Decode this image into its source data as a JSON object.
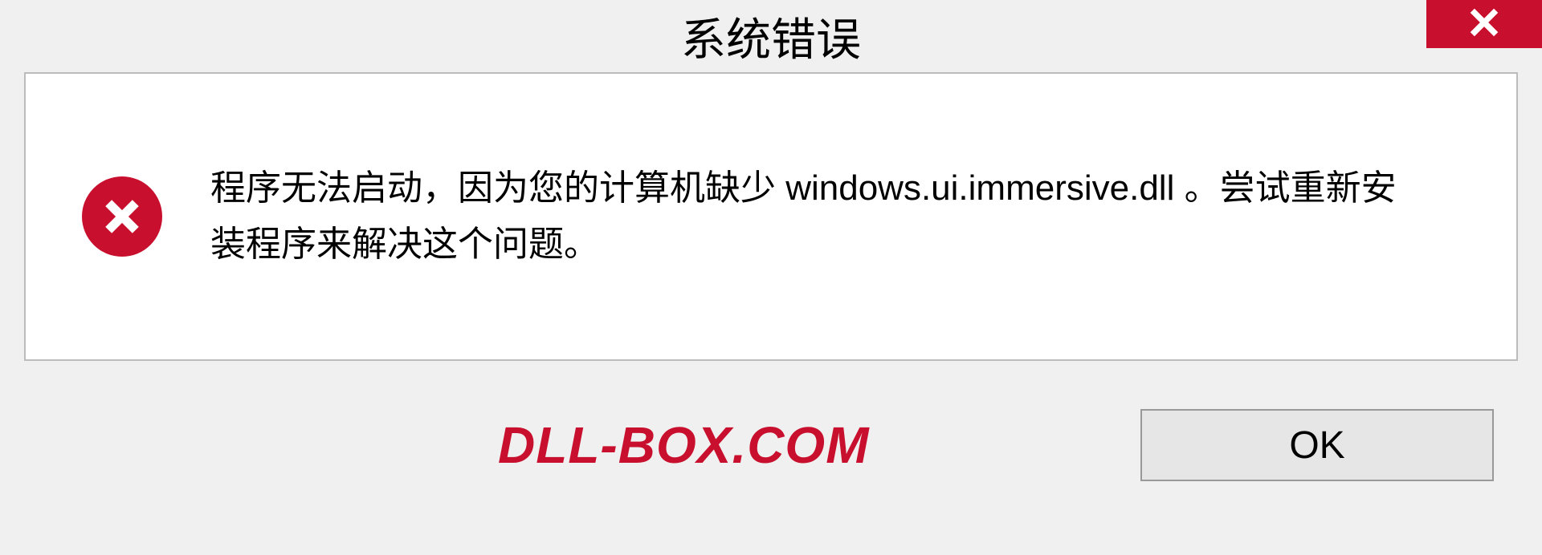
{
  "titlebar": {
    "title": "系统错误"
  },
  "content": {
    "message": "程序无法启动，因为您的计算机缺少 windows.ui.immersive.dll 。尝试重新安装程序来解决这个问题。"
  },
  "footer": {
    "watermark": "DLL-BOX.COM",
    "ok_label": "OK"
  },
  "colors": {
    "accent_red": "#c8102e"
  }
}
